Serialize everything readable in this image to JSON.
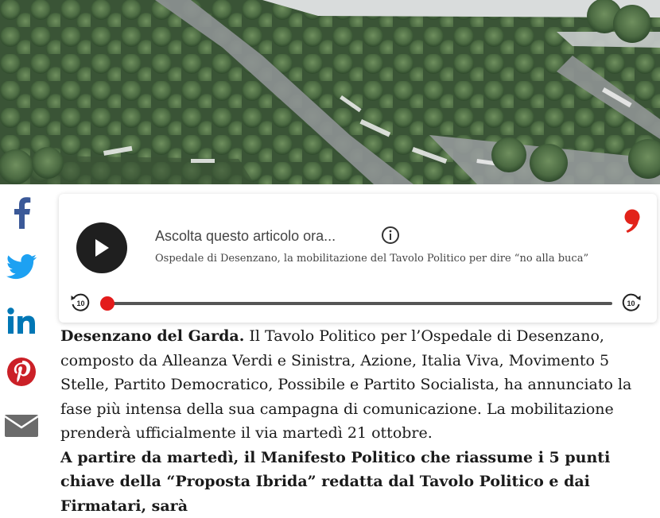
{
  "hero": {
    "image_subject": "aerial rendering of a tree-lined car park"
  },
  "share": {
    "items": [
      {
        "network": "facebook",
        "icon": "facebook-icon",
        "color": "#3b5998"
      },
      {
        "network": "twitter",
        "icon": "twitter-icon",
        "color": "#1da1f2"
      },
      {
        "network": "linkedin",
        "icon": "linkedin-icon",
        "color": "#0077b5"
      },
      {
        "network": "pinterest",
        "icon": "pinterest-icon",
        "color": "#cb2027"
      },
      {
        "network": "email",
        "icon": "mail-icon",
        "color": "#6b6b6b"
      }
    ]
  },
  "player": {
    "title": "Ascolta questo articolo ora...",
    "subtitle": "Ospedale di Desenzano, la mobilitazione del Tavolo Politico per dire “no alla buca”",
    "skip_back_label": "10",
    "skip_forward_label": "10",
    "progress": 0,
    "accent_color": "#e31b1b"
  },
  "article": {
    "dateline": "Desenzano del Garda.",
    "paragraph1": " Il Tavolo Politico per l’Ospedale di Desenzano, composto da Alleanza Verdi e Sinistra, Azione, Italia Viva, Movimento 5 Stelle, Partito Democratico, Possibile e Partito Socialista, ha annunciato la fase più intensa della sua campagna di comunicazione. La mobilitazione prenderà ufficialmente il via martedì 21 ottobre.",
    "paragraph2_bold": "A partire da martedì, il Manifesto Politico che riassume i 5 punti chiave della “Proposta Ibrida” redatta dal Tavolo Politico e dai Firmatari, sarà"
  }
}
